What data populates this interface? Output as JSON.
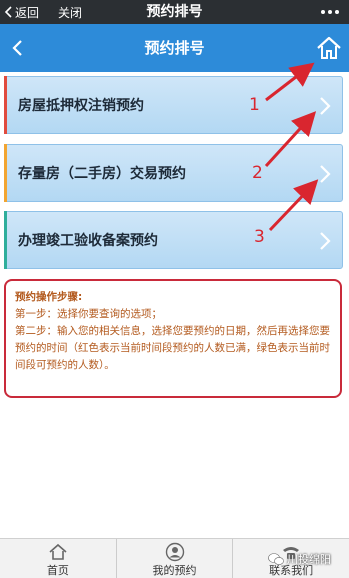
{
  "wechat_bar": {
    "back_label": "返回",
    "close_label": "关闭",
    "title": "预约排号"
  },
  "header": {
    "title": "预约排号"
  },
  "menu": {
    "items": [
      {
        "label": "房屋抵押权注销预约",
        "accent": "#e04b3e"
      },
      {
        "label": "存量房（二手房）交易预约",
        "accent": "#f2a531"
      },
      {
        "label": "办理竣工验收备案预约",
        "accent": "#2fae9b"
      }
    ]
  },
  "annotations": {
    "arrow_color": "#d9262f",
    "numbers": [
      "1",
      "2",
      "3"
    ]
  },
  "instructions": {
    "title": "预约操作步骤:",
    "step1": "第一步：选择你要查询的选项；",
    "step2": "第二步：输入您的相关信息，选择您要预约的日期，然后再选择您要预约的时间（红色表示当前时间段预约的人数已满，绿色表示当前时间段可预约的人数）。"
  },
  "tabbar": {
    "tabs": [
      {
        "label": "首页",
        "icon": "home-icon"
      },
      {
        "label": "我的预约",
        "icon": "user-icon"
      },
      {
        "label": "联系我们",
        "icon": "phone-icon"
      }
    ]
  },
  "watermark": {
    "text": "川投绵阳"
  },
  "colors": {
    "header_blue": "#2d8bd9",
    "card_blue": "#c4e0f6",
    "info_border": "#c92a3a",
    "info_text": "#b35a1e"
  }
}
